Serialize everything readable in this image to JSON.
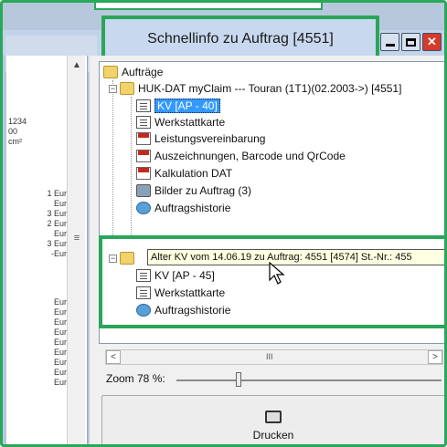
{
  "window": {
    "title": "Schnellinfo zu Auftrag [4551]"
  },
  "left_panel": {
    "values": [
      "1234",
      "00",
      "cm²",
      "1 Eur",
      "Eur",
      "3 Eur",
      "2 Eur",
      "Eur",
      "3 Eur",
      "-Eur",
      "Eur",
      "Eur",
      "Eur",
      "Eur",
      "Eur",
      "Eur",
      "Eur",
      "Eur",
      "Eur"
    ]
  },
  "tree": {
    "root": "Aufträge",
    "order": "HUK-DAT myClaim  --- Touran (1T1)(02.2003->) [4551]",
    "items": [
      {
        "label": "KV [AP - 40]",
        "icon": "document-icon",
        "selected": true
      },
      {
        "label": "Werkstattkarte",
        "icon": "document-icon"
      },
      {
        "label": "Leistungsvereinbarung",
        "icon": "pdf-icon"
      },
      {
        "label": "Auszeichnungen, Barcode und QrCode",
        "icon": "pdf-icon"
      },
      {
        "label": "Kalkulation DAT",
        "icon": "pdf-icon"
      },
      {
        "label": "Bilder zu Auftrag (3)",
        "icon": "image-icon"
      },
      {
        "label": "Auftragshistorie",
        "icon": "history-icon"
      }
    ],
    "old_kv": {
      "tooltip": "Alter KV vom 14.06.19 zu Auftrag: 4551 [4574] St.-Nr.: 455",
      "items": [
        {
          "label": "KV [AP - 45]",
          "icon": "document-icon"
        },
        {
          "label": "Werkstattkarte",
          "icon": "document-icon"
        },
        {
          "label": "Auftragshistorie",
          "icon": "history-icon"
        }
      ]
    }
  },
  "zoom": {
    "label": "Zoom 78 %:",
    "value": 78
  },
  "print_button": {
    "label": "Drucken"
  },
  "scroll": {
    "grip": "III"
  },
  "colors": {
    "highlight": "#2aa55a",
    "selection": "#3399ff",
    "close": "#d63a2a"
  }
}
